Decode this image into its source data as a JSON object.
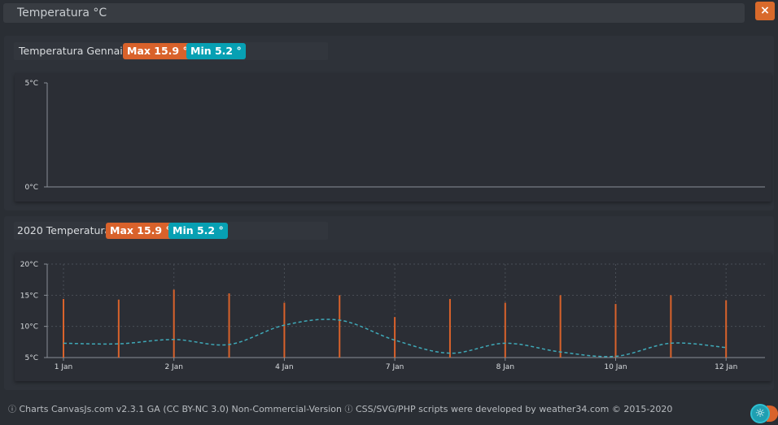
{
  "window": {
    "title": "Temperatura °C",
    "close_label": "×"
  },
  "panel1": {
    "title": "Temperatura Gennaio",
    "max_badge": "Max 15.9 °",
    "min_badge": "Min 5.2 °"
  },
  "panel2": {
    "title": "2020 Temperatura",
    "max_badge": "Max 15.9 °",
    "min_badge": "Min 5.2 °"
  },
  "footer": {
    "info_icon": "info-circle-icon",
    "text1": "Charts CanvasJs.com v2.3.1 GA (CC BY-NC 3.0) Non-Commercial-Version",
    "text2": "CSS/SVG/PHP scripts were developed by weather34.com © 2015-2020"
  },
  "colors": {
    "accent_orange": "#d9622b",
    "accent_teal": "#07a0b3",
    "dashed_line": "#3fa9b8"
  },
  "chart_data": [
    {
      "type": "line",
      "yticks": [
        "0°C",
        "5°C"
      ],
      "ylim": [
        0,
        5
      ],
      "series": []
    },
    {
      "type": "bar",
      "x_ticks": [
        "1 Jan",
        "2 Jan",
        "4 Jan",
        "7 Jan",
        "8 Jan",
        "10 Jan",
        "12 Jan"
      ],
      "yticks": [
        "5°C",
        "10°C",
        "15°C",
        "20°C"
      ],
      "ylim": [
        5,
        20
      ],
      "grid": true,
      "series": [
        {
          "kind": "bar",
          "x": [
            0,
            0.5,
            1.0,
            1.5,
            2.0,
            2.5,
            3.0,
            3.5,
            4.0,
            4.5,
            5.0,
            5.5,
            6.0
          ],
          "values": [
            14.4,
            14.3,
            15.9,
            15.3,
            13.8,
            15.0,
            11.5,
            14.4,
            13.8,
            15.0,
            13.6,
            15.0,
            14.2
          ]
        },
        {
          "kind": "line-dashed",
          "x": [
            0,
            0.5,
            1.0,
            1.5,
            2.0,
            2.5,
            3.0,
            3.5,
            4.0,
            4.5,
            5.0,
            5.5,
            6.0
          ],
          "values": [
            7.3,
            7.2,
            7.9,
            7.1,
            10.2,
            11.0,
            7.8,
            5.7,
            7.3,
            5.9,
            5.2,
            7.3,
            6.6
          ]
        }
      ]
    }
  ]
}
